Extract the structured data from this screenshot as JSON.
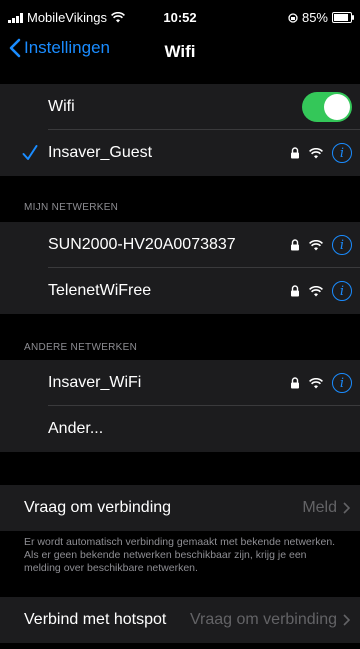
{
  "status_bar": {
    "carrier": "MobileVikings",
    "time": "10:52",
    "battery_percent": "85%",
    "battery_level": 0.85
  },
  "nav": {
    "back_label": "Instellingen",
    "title": "Wifi"
  },
  "wifi_toggle": {
    "label": "Wifi",
    "on": true
  },
  "connected_network": {
    "name": "Insaver_Guest"
  },
  "my_networks": {
    "header": "MIJN NETWERKEN",
    "items": [
      {
        "name": "SUN2000-HV20A0073837"
      },
      {
        "name": "TelenetWiFree"
      }
    ]
  },
  "other_networks": {
    "header": "ANDERE NETWERKEN",
    "items": [
      {
        "name": "Insaver_WiFi"
      },
      {
        "name": "Ander..."
      }
    ]
  },
  "ask_to_join": {
    "label": "Vraag om verbinding",
    "value": "Meld",
    "description": "Er wordt automatisch verbinding gemaakt met bekende netwerken. Als er geen bekende netwerken beschikbaar zijn, krijg je een melding over beschikbare netwerken."
  },
  "hotspot": {
    "label": "Verbind met hotspot",
    "value": "Vraag om verbinding"
  },
  "colors": {
    "accent": "#1a8cff",
    "toggle_on": "#34c759",
    "cell_bg": "#1c1c1e",
    "secondary_text": "#8e8e93"
  },
  "icons": [
    "signal-icon",
    "wifi-icon",
    "battery-icon",
    "back-chevron-icon",
    "checkmark-icon",
    "lock-icon",
    "info-icon",
    "chevron-right-icon"
  ]
}
